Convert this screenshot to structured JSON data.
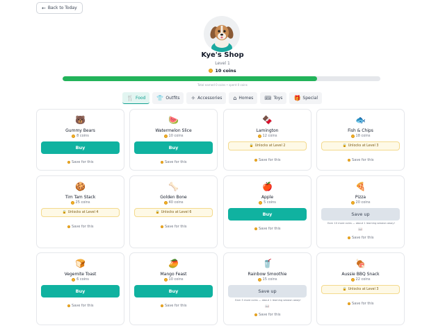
{
  "back_button": "Back to Today",
  "shop": {
    "title": "Kye's Shop",
    "level": "Level 1",
    "coins": "10 coins",
    "progress": 0.8,
    "progress_note": "Total earned 0 coins • spent 0 coins"
  },
  "tabs": [
    {
      "label": "Food",
      "icon": "fork-knife-icon",
      "active": true
    },
    {
      "label": "Outfits",
      "icon": "shirt-icon"
    },
    {
      "label": "Accessories",
      "icon": "sparkle-icon"
    },
    {
      "label": "Homes",
      "icon": "house-icon"
    },
    {
      "label": "Toys",
      "icon": "ticket-icon"
    },
    {
      "label": "Special",
      "icon": "gift-icon"
    }
  ],
  "items": [
    {
      "emoji": "🐻",
      "name": "Gummy Bears",
      "price": "8 coins",
      "state": "buy",
      "button": "Buy",
      "save": "Save for this"
    },
    {
      "emoji": "🍉",
      "name": "Watermelon Slice",
      "price": "10 coins",
      "state": "buy",
      "button": "Buy",
      "save": "Save for this"
    },
    {
      "emoji": "🍫",
      "name": "Lamington",
      "price": "12 coins",
      "state": "locked",
      "lock_text": "Unlocks at Level 2",
      "save": "Save for this"
    },
    {
      "emoji": "🐟",
      "name": "Fish & Chips",
      "price": "18 coins",
      "state": "locked",
      "lock_text": "Unlocks at Level 3",
      "save": "Save for this"
    },
    {
      "emoji": "🍪",
      "name": "Tim Tam Stack",
      "price": "25 coins",
      "state": "locked",
      "lock_text": "Unlocks at Level 4",
      "save": "Save for this"
    },
    {
      "emoji": "🦴",
      "name": "Golden Bone",
      "price": "40 coins",
      "state": "locked",
      "lock_text": "Unlocks at Level 6",
      "save": "Save for this"
    },
    {
      "emoji": "🍎",
      "name": "Apple",
      "price": "5 coins",
      "state": "buy",
      "button": "Buy",
      "save": "Save for this"
    },
    {
      "emoji": "🍕",
      "name": "Pizza",
      "price": "20 coins",
      "state": "saveup",
      "button": "Save up",
      "earn_note": "Earn 10 more coins — about 1 learning session away!",
      "save": "Save for this"
    },
    {
      "emoji": "🍞",
      "name": "Vegemite Toast",
      "price": "6 coins",
      "state": "buy",
      "button": "Buy",
      "save": "Save for this"
    },
    {
      "emoji": "🥭",
      "name": "Mango Feast",
      "price": "10 coins",
      "state": "buy",
      "button": "Buy",
      "save": "Save for this"
    },
    {
      "emoji": "🥤",
      "name": "Rainbow Smoothie",
      "price": "15 coins",
      "state": "saveup",
      "button": "Save up",
      "earn_note": "Earn 5 more coins — about 1 learning session away!",
      "save": "Save for this"
    },
    {
      "emoji": "🍖",
      "name": "Aussie BBQ Snack",
      "price": "22 coins",
      "state": "locked",
      "lock_text": "Unlocks at Level 3",
      "save": "Save for this"
    }
  ]
}
